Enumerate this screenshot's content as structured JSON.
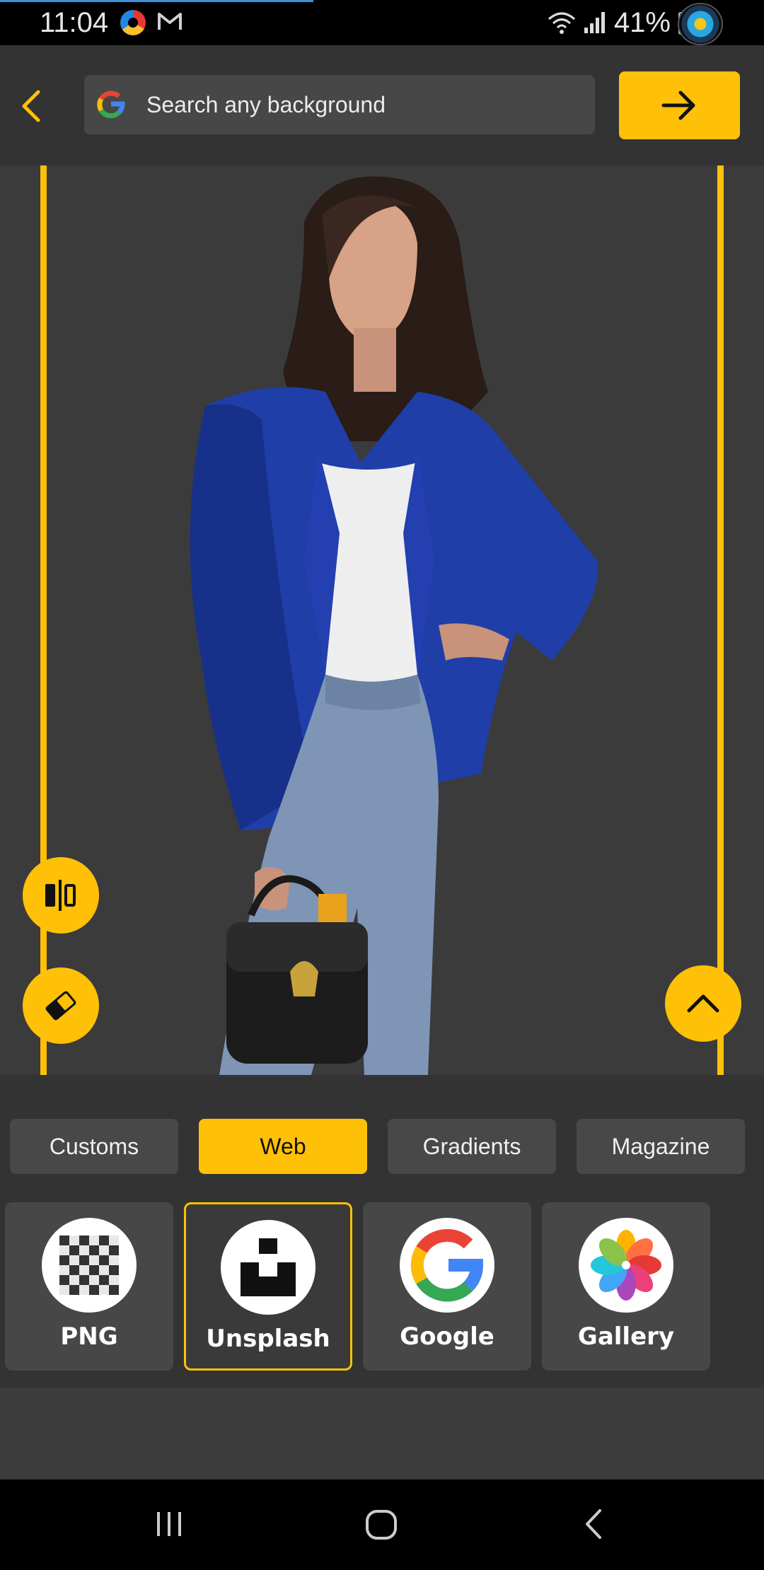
{
  "status_bar": {
    "time": "11:04",
    "battery": "41%",
    "icons": [
      "app-icon",
      "gmail-icon",
      "wifi-icon",
      "signal-icon",
      "battery-charging-icon",
      "avatar-icon"
    ]
  },
  "header": {
    "search_placeholder": "Search any background",
    "icons": [
      "back-icon",
      "google-icon",
      "arrow-right-icon"
    ]
  },
  "colors": {
    "accent": "#ffc107",
    "background": "#3b3b3b",
    "panel": "#333333",
    "button": "#484848"
  },
  "canvas": {
    "tools": [
      "compare-icon",
      "eraser-icon",
      "chevron-up-icon"
    ]
  },
  "tabs": [
    {
      "label": "Customs",
      "active": false
    },
    {
      "label": "Web",
      "active": true
    },
    {
      "label": "Gradients",
      "active": false
    },
    {
      "label": "Magazine",
      "active": false
    }
  ],
  "sources": [
    {
      "label": "PNG",
      "icon": "transparent-grid-icon",
      "active": false
    },
    {
      "label": "Unsplash",
      "icon": "unsplash-icon",
      "active": true
    },
    {
      "label": "Google",
      "icon": "google-icon",
      "active": false
    },
    {
      "label": "Gallery",
      "icon": "gallery-flower-icon",
      "active": false
    }
  ],
  "nav_bar": {
    "icons": [
      "recents-icon",
      "home-icon",
      "back-nav-icon"
    ]
  }
}
